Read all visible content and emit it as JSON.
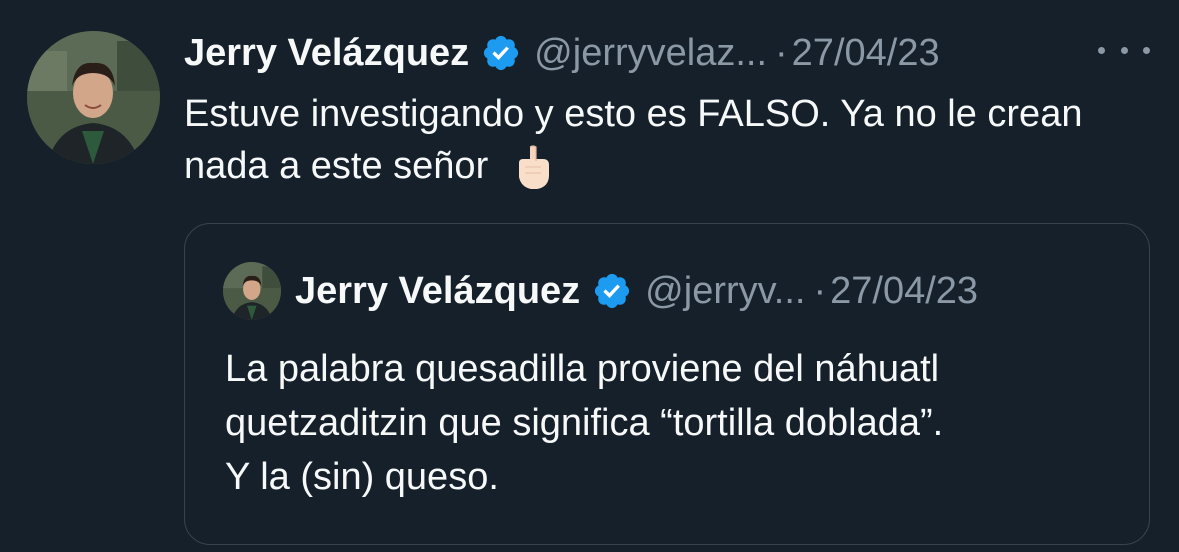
{
  "tweet": {
    "author_name": "Jerry Velázquez",
    "handle": "@jerryvelaz...",
    "separator": "·",
    "date": "27/04/23",
    "text": "Estuve investigando y esto es FALSO. Ya no le crean nada a este señor",
    "emoji_icon": "pointing-down-hand-icon"
  },
  "quoted_tweet": {
    "author_name": "Jerry Velázquez",
    "handle": "@jerryv...",
    "separator": "·",
    "date": "27/04/23",
    "lines": [
      "La palabra quesadilla proviene del náhuatl",
      "quetzaditzin que significa “tortilla doblada”.",
      "Y la (sin) queso."
    ]
  },
  "colors": {
    "background": "#15202b",
    "text_primary": "#f7f9f9",
    "text_secondary": "#8b98a5",
    "verified_blue": "#1d9bf0",
    "border": "#38444d"
  }
}
